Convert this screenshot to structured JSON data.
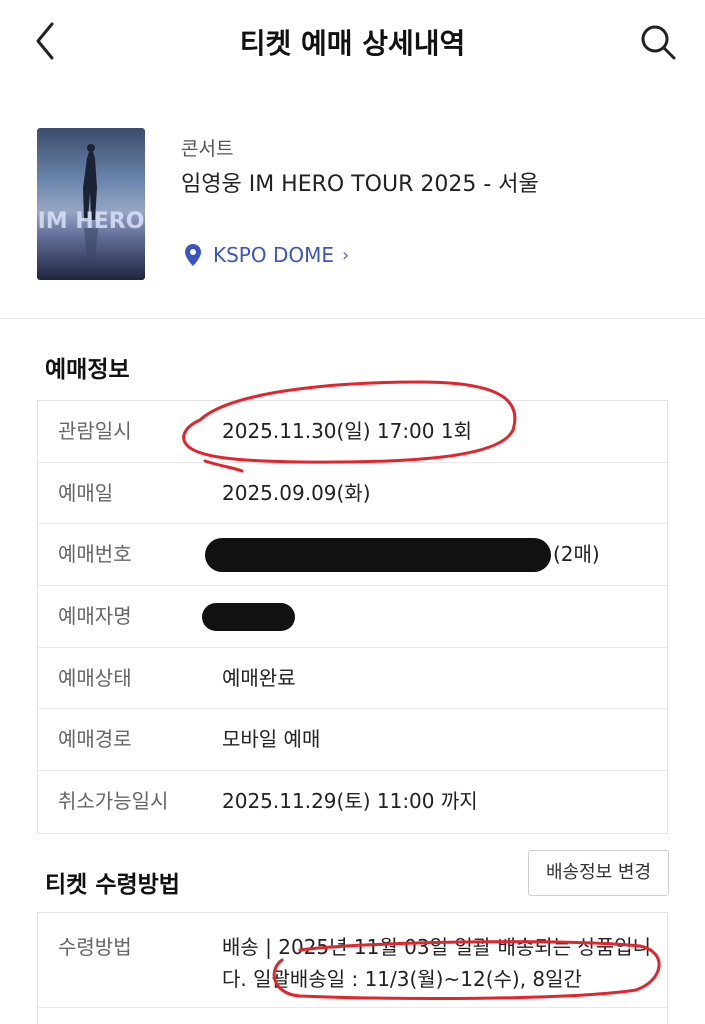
{
  "header": {
    "title": "티켓 예매 상세내역"
  },
  "event": {
    "genre": "콘서트",
    "title": "임영웅 IM HERO TOUR 2025 - 서울",
    "venue": "KSPO DOME",
    "venue_chevron": "›",
    "poster_text": "IM HERO"
  },
  "booking_info": {
    "section_title": "예매정보",
    "rows": [
      {
        "label": "관람일시",
        "value": "2025.11.30(일) 17:00 1회"
      },
      {
        "label": "예매일",
        "value": "2025.09.09(화)"
      },
      {
        "label": "예매번호",
        "value": "(2매)"
      },
      {
        "label": "예매자명",
        "value": ""
      },
      {
        "label": "예매상태",
        "value": "예매완료"
      },
      {
        "label": "예매경로",
        "value": "모바일 예매"
      },
      {
        "label": "취소가능일시",
        "value": "2025.11.29(토) 11:00 까지"
      }
    ]
  },
  "ticket_receipt": {
    "section_title": "티켓 수령방법",
    "change_button": "배송정보 변경",
    "method_label": "수령방법",
    "method_value": "배송 | 2025년 11월 03일 일괄 배송되는 상품입니다. 일괄배송일 : 11/3(월)~12(수), 8일간"
  },
  "colors": {
    "accent": "#3d55c4",
    "annotation": "#e5232b"
  }
}
